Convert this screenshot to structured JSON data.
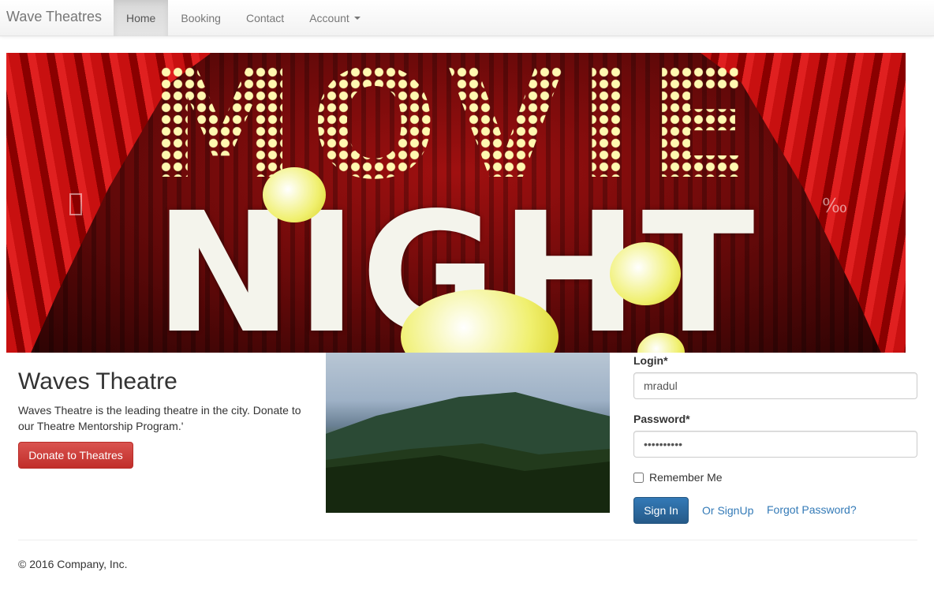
{
  "navbar": {
    "brand": "Wave Theatres",
    "items": [
      {
        "label": "Home"
      },
      {
        "label": "Booking"
      },
      {
        "label": "Contact"
      },
      {
        "label": "Account"
      }
    ]
  },
  "banner": {
    "word_top": "MOVIE",
    "word_bottom": "NIGHT",
    "prev_icon": "chevron-left-icon",
    "next_glyph": "‰"
  },
  "info": {
    "title": "Waves Theatre",
    "text": "Waves Theatre is the leading theatre in the city. Donate to our Theatre Mentorship Program.'",
    "donate_label": "Donate to Theatres"
  },
  "login": {
    "login_label": "Login*",
    "login_value": "mradul",
    "password_label": "Password*",
    "password_value": "••••••••••",
    "remember_label": "Remember Me",
    "signin_label": "Sign In",
    "signup_label": "Or SignUp",
    "forgot_label": "Forgot Password?"
  },
  "footer": {
    "copyright": "© 2016 Company, Inc."
  },
  "colors": {
    "danger": "#d9534f",
    "primary": "#337ab7",
    "link": "#337ab7"
  }
}
